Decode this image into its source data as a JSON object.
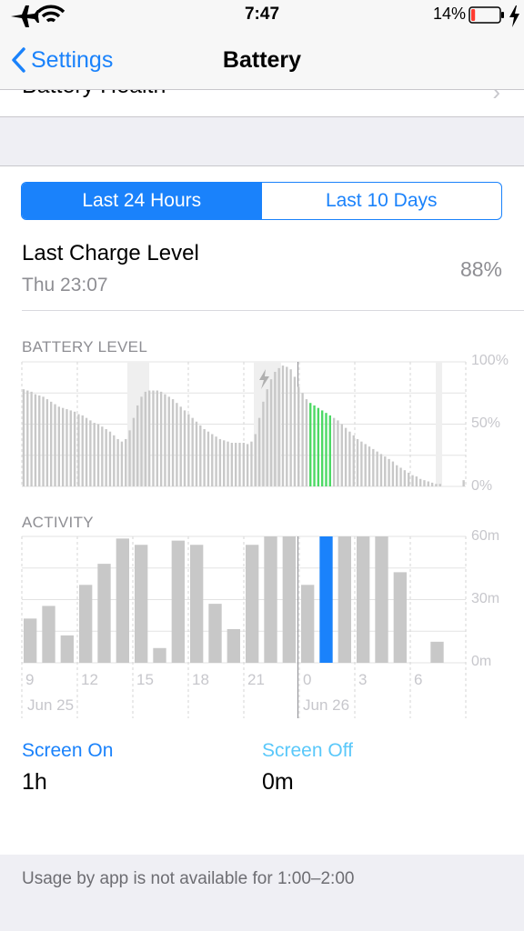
{
  "status_bar": {
    "time": "7:47",
    "battery_percent": "14%",
    "battery_level": 0.14
  },
  "nav": {
    "back_label": "Settings",
    "title": "Battery"
  },
  "health_row": {
    "label": "Battery Health"
  },
  "segmented": {
    "options": [
      "Last 24 Hours",
      "Last 10 Days"
    ],
    "selected": 0
  },
  "last_charge": {
    "title": "Last Charge Level",
    "time": "Thu 23:07",
    "percent": "88%"
  },
  "battery_chart": {
    "label": "BATTERY LEVEL",
    "y_ticks": [
      "100%",
      "50%",
      "0%"
    ]
  },
  "activity_chart": {
    "label": "ACTIVITY",
    "y_ticks": [
      "60m",
      "30m",
      "0m"
    ]
  },
  "x_axis": {
    "ticks": [
      "9",
      "12",
      "15",
      "18",
      "21",
      "0",
      "3",
      "6"
    ],
    "dates": [
      "Jun 25",
      "Jun 26"
    ]
  },
  "legend": {
    "screen_on": {
      "label": "Screen On",
      "value": "1h",
      "color": "#1a82fb"
    },
    "screen_off": {
      "label": "Screen Off",
      "value": "0m",
      "color": "#5ac8fa"
    }
  },
  "footer": {
    "text": "Usage by app is not available for 1:00–2:00"
  },
  "colors": {
    "accent": "#1a82fb",
    "bar_gray": "#c8c8c8",
    "charging_green": "#4cd964"
  },
  "chart_data": [
    {
      "type": "bar",
      "title": "BATTERY LEVEL",
      "ylabel": "",
      "ylim": [
        0,
        100
      ],
      "x": [
        "9",
        "",
        "",
        "",
        "",
        "",
        "",
        "",
        "",
        "",
        "",
        "",
        "12",
        "",
        "",
        "",
        "",
        "",
        "",
        "",
        "",
        "",
        "",
        "",
        "15",
        "",
        "",
        "",
        "",
        "",
        "",
        "",
        "",
        "",
        "",
        "",
        "18",
        "",
        "",
        "",
        "",
        "",
        "",
        "",
        "",
        "",
        "",
        "",
        "21",
        "",
        "",
        "",
        "",
        "",
        "",
        "",
        "",
        "",
        "",
        "",
        "0",
        "",
        "",
        "",
        "",
        "",
        "",
        "",
        "",
        "",
        "",
        "",
        "3",
        "",
        "",
        "",
        "",
        "",
        "",
        "",
        "",
        "",
        "",
        "",
        "6",
        "",
        "",
        "",
        "",
        "",
        "",
        "",
        "",
        "",
        ""
      ],
      "values": [
        78,
        77,
        76,
        74,
        73,
        72,
        70,
        68,
        66,
        64,
        63,
        62,
        61,
        60,
        58,
        57,
        55,
        53,
        51,
        50,
        48,
        46,
        44,
        41,
        38,
        36,
        38,
        45,
        55,
        65,
        72,
        76,
        77,
        77,
        77,
        76,
        74,
        72,
        70,
        67,
        64,
        61,
        58,
        55,
        52,
        49,
        46,
        44,
        42,
        40,
        38,
        37,
        36,
        35,
        35,
        35,
        35,
        34,
        36,
        42,
        55,
        68,
        78,
        86,
        92,
        95,
        97,
        96,
        94,
        88,
        80,
        75,
        70,
        67,
        65,
        63,
        61,
        59,
        57,
        55,
        53,
        50,
        47,
        44,
        41,
        38,
        36,
        34,
        32,
        30,
        28,
        26,
        24,
        22,
        20,
        17,
        15,
        13,
        11,
        9,
        8,
        6,
        5,
        4,
        3,
        2,
        2,
        0,
        0,
        0,
        0,
        0,
        5
      ],
      "series": [
        {
          "name": "",
          "values": []
        }
      ]
    },
    {
      "type": "bar",
      "title": "ACTIVITY",
      "ylabel": "",
      "ylim": [
        0,
        60
      ],
      "categories": [
        "9",
        "",
        "",
        "12",
        "",
        "",
        "15",
        "",
        "",
        "18",
        "",
        "",
        "21",
        "",
        "",
        "0",
        "",
        "",
        "3",
        "",
        "",
        "6",
        "",
        ""
      ],
      "values": [
        21,
        27,
        13,
        37,
        47,
        59,
        56,
        7,
        58,
        56,
        28,
        16,
        56,
        60,
        60,
        37,
        60,
        60,
        60,
        60,
        43,
        0,
        10,
        0
      ],
      "highlight_index": 16
    }
  ]
}
